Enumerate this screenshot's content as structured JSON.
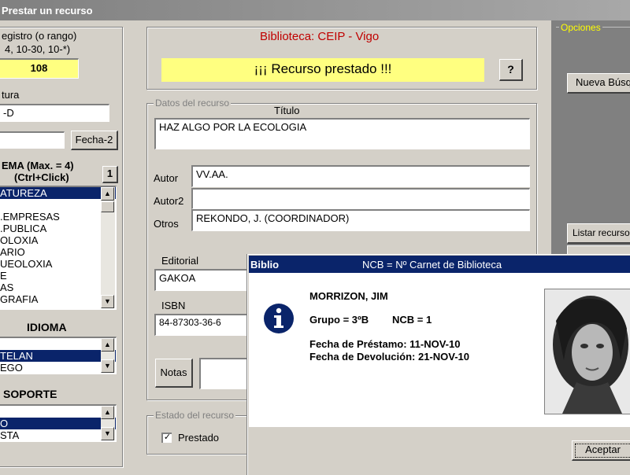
{
  "window": {
    "title": "Prestar un recurso"
  },
  "left": {
    "registro_label_1": "egistro  (o rango)",
    "registro_label_2": "4, 10-30, 10-*)",
    "registro_value": "108",
    "signatura_label": "tura",
    "signatura_value": "-D",
    "fecha2_button": "Fecha-2",
    "tema_heading_1": "EMA (Max. = 4)",
    "tema_heading_2": "(Ctrl+Click)",
    "tema_button": "1",
    "tema_items": [
      "ATUREZA",
      "",
      ".EMPRESAS",
      ".PUBLICA",
      "OLOXIA",
      "ARIO",
      "UEOLOXIA",
      "E",
      "AS",
      "GRAFIA"
    ],
    "idioma_heading": "IDIOMA",
    "idioma_items": [
      "",
      "TELAN",
      "EGO"
    ],
    "soporte_heading": "SOPORTE",
    "soporte_items": [
      "",
      "O",
      "STA"
    ]
  },
  "center": {
    "library_name": "Biblioteca: CEIP - Vigo",
    "status_message": "¡¡¡ Recurso prestado !!!",
    "help_button": "?",
    "group_label": "Datos del recurso",
    "titulo_label": "Título",
    "titulo_value": "HAZ ALGO POR LA ECOLOGIA",
    "autor_label": "Autor",
    "autor_value": "VV.AA.",
    "autor2_label": "Autor2",
    "autor2_value": "",
    "otros_label": "Otros",
    "otros_value": "REKONDO, J. (COORDINADOR)",
    "editorial_label": "Editorial",
    "editorial_value": "GAKOA",
    "isbn_label": "ISBN",
    "isbn_value": "84-87303-36-6",
    "notas_button": "Notas",
    "estado_label": "Estado del recurso",
    "prestado_label": "Prestado"
  },
  "right": {
    "opciones_label": "Opciones",
    "nueva_busqueda_button": "Nueva Búsq",
    "listar_button": "Listar recurso"
  },
  "dialog": {
    "title_left": "Biblio",
    "title_center": "NCB = Nº Carnet de Biblioteca",
    "name": "MORRIZON, JIM",
    "grupo": "Grupo = 3ºB",
    "ncb": "NCB = 1",
    "fecha_prestamo": "Fecha de Préstamo:  11-NOV-10",
    "fecha_devolucion": "Fecha de Devolución:  21-NOV-10",
    "aceptar_button": "Aceptar"
  },
  "colors": {
    "title_active": "#0a246a",
    "highlight_yellow": "#ffff80",
    "library_red": "#c00000"
  }
}
